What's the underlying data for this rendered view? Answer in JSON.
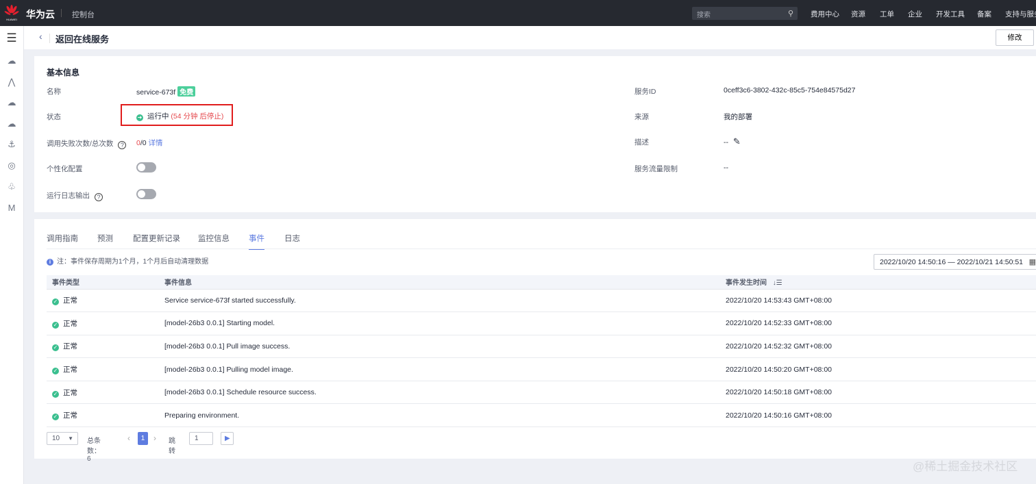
{
  "topbar": {
    "logo_text": "HUAWEI",
    "brand": "华为云",
    "console": "控制台",
    "search_placeholder": "搜索",
    "nav": [
      "费用中心",
      "资源",
      "工单",
      "企业",
      "开发工具",
      "备案",
      "支持与服务"
    ]
  },
  "header": {
    "title": "返回在线服务",
    "edit_label": "修改"
  },
  "basic": {
    "section_title": "基本信息",
    "name_label": "名称",
    "name_value": "service-673f",
    "free_tag": "免费",
    "status_label": "状态",
    "status_value": "运行中",
    "status_note": "(54 分钟 后停止)",
    "calls_label": "调用失败次数/总次数",
    "calls_failed": "0",
    "calls_total": "/0",
    "details_link": "详情",
    "custom_label": "个性化配置",
    "custom_enabled": false,
    "log_label": "运行日志输出",
    "log_enabled": false,
    "id_label": "服务ID",
    "id_value": "0ceff3c6-3802-432c-85c5-754e84575d27",
    "source_label": "来源",
    "source_value": "我的部署",
    "desc_label": "描述",
    "desc_value": "--",
    "limit_label": "服务流量限制",
    "limit_value": "--"
  },
  "tabs": [
    "调用指南",
    "预测",
    "配置更新记录",
    "监控信息",
    "事件",
    "日志"
  ],
  "active_tab": "事件",
  "note": "注：事件保存周期为1个月，1个月后自动清理数据",
  "date_range": "2022/10/20 14:50:16 — 2022/10/21 14:50:51",
  "table": {
    "headers": [
      "事件类型",
      "事件信息",
      "事件发生时间"
    ],
    "rows": [
      {
        "type": "正常",
        "info": "Service service-673f started successfully.",
        "time": "2022/10/20 14:53:43 GMT+08:00"
      },
      {
        "type": "正常",
        "info": "[model-26b3 0.0.1] Starting model.",
        "time": "2022/10/20 14:52:33 GMT+08:00"
      },
      {
        "type": "正常",
        "info": "[model-26b3 0.0.1] Pull image success.",
        "time": "2022/10/20 14:52:32 GMT+08:00"
      },
      {
        "type": "正常",
        "info": "[model-26b3 0.0.1] Pulling model image.",
        "time": "2022/10/20 14:50:20 GMT+08:00"
      },
      {
        "type": "正常",
        "info": "[model-26b3 0.0.1] Schedule resource success.",
        "time": "2022/10/20 14:50:18 GMT+08:00"
      },
      {
        "type": "正常",
        "info": "Preparing environment.",
        "time": "2022/10/20 14:50:16 GMT+08:00"
      }
    ]
  },
  "pager": {
    "page_size": "10",
    "total_label": "总条数：6",
    "current": "1",
    "jump_label": "跳转",
    "jump_value": "1"
  },
  "watermark": "@稀土掘金技术社区"
}
